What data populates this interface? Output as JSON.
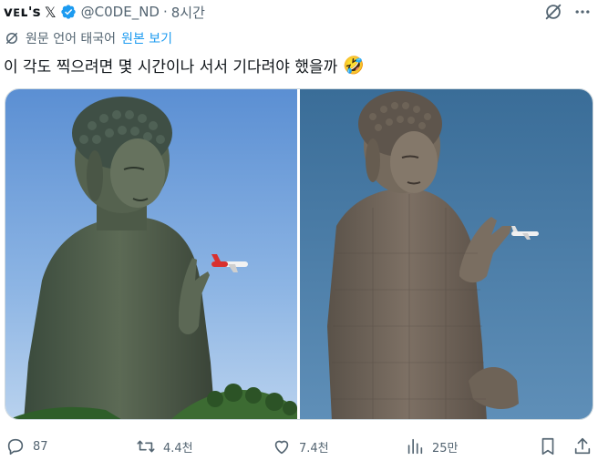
{
  "header": {
    "display_name": "ᴠᴇʟ's",
    "x_glyph": "𝕏",
    "handle": "@C0DE_ND",
    "separator": "·",
    "time": "8시간"
  },
  "translation": {
    "label": "원문 언어 태국어",
    "link": "원본 보기"
  },
  "tweet": {
    "text": "이 각도 찍으려면 몇 시간이나 서서 기다려야 했을까",
    "emoji": "🤣"
  },
  "media": [
    {
      "alt": "Great Buddha statue with an airplane between its fingers, blue sky and green hill"
    },
    {
      "alt": "Ushiku Daibutsu statue with an airplane between its fingers against blue sky"
    }
  ],
  "actions": {
    "reply_count": "87",
    "retweet_count": "4.4천",
    "like_count": "7.4천",
    "view_count": "25만"
  },
  "colors": {
    "accent": "#1d9bf0",
    "muted": "#536471",
    "text": "#0f1419"
  },
  "icons": [
    "verified-badge-icon",
    "grok-icon",
    "more-icon",
    "translate-icon",
    "reply-icon",
    "retweet-icon",
    "like-icon",
    "views-icon",
    "bookmark-icon",
    "share-icon"
  ]
}
